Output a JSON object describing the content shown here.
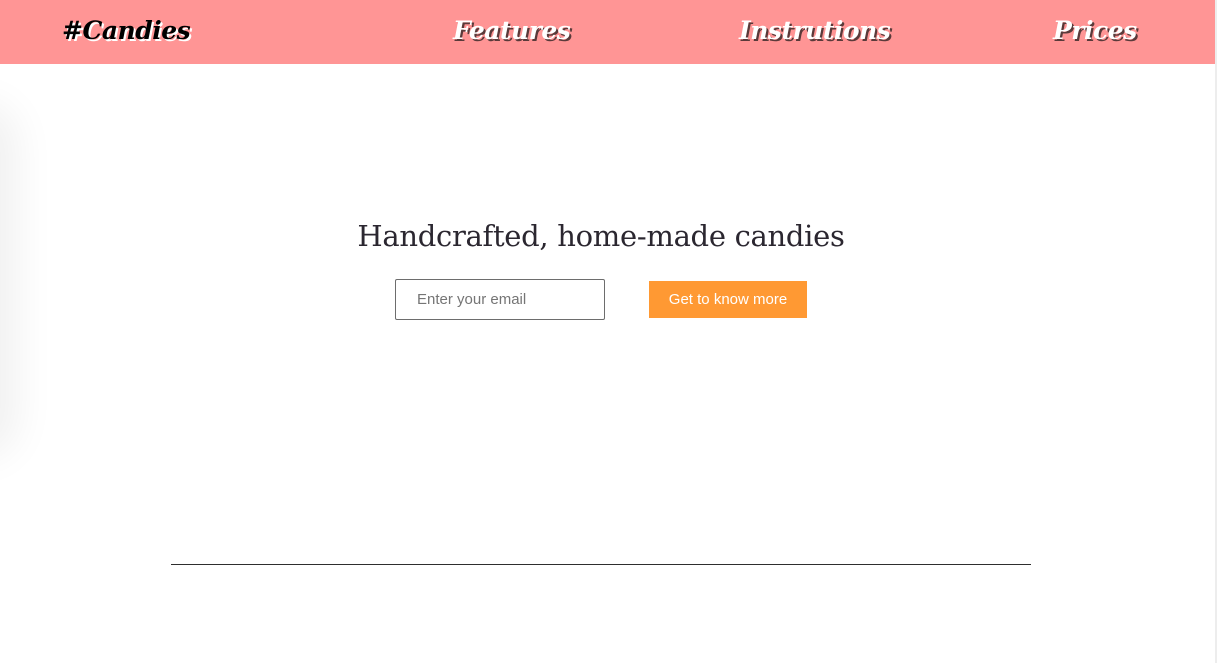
{
  "navbar": {
    "brand": "#Candies",
    "links": [
      {
        "label": "Features"
      },
      {
        "label": "Instrutions"
      },
      {
        "label": "Prices"
      }
    ],
    "background_color": "#ff9595"
  },
  "hero": {
    "title": "Handcrafted, home-made candies",
    "email_input": {
      "value": "",
      "placeholder": "Enter your email"
    },
    "cta_button": {
      "label": "Get to know more",
      "color": "#ff9933"
    }
  }
}
